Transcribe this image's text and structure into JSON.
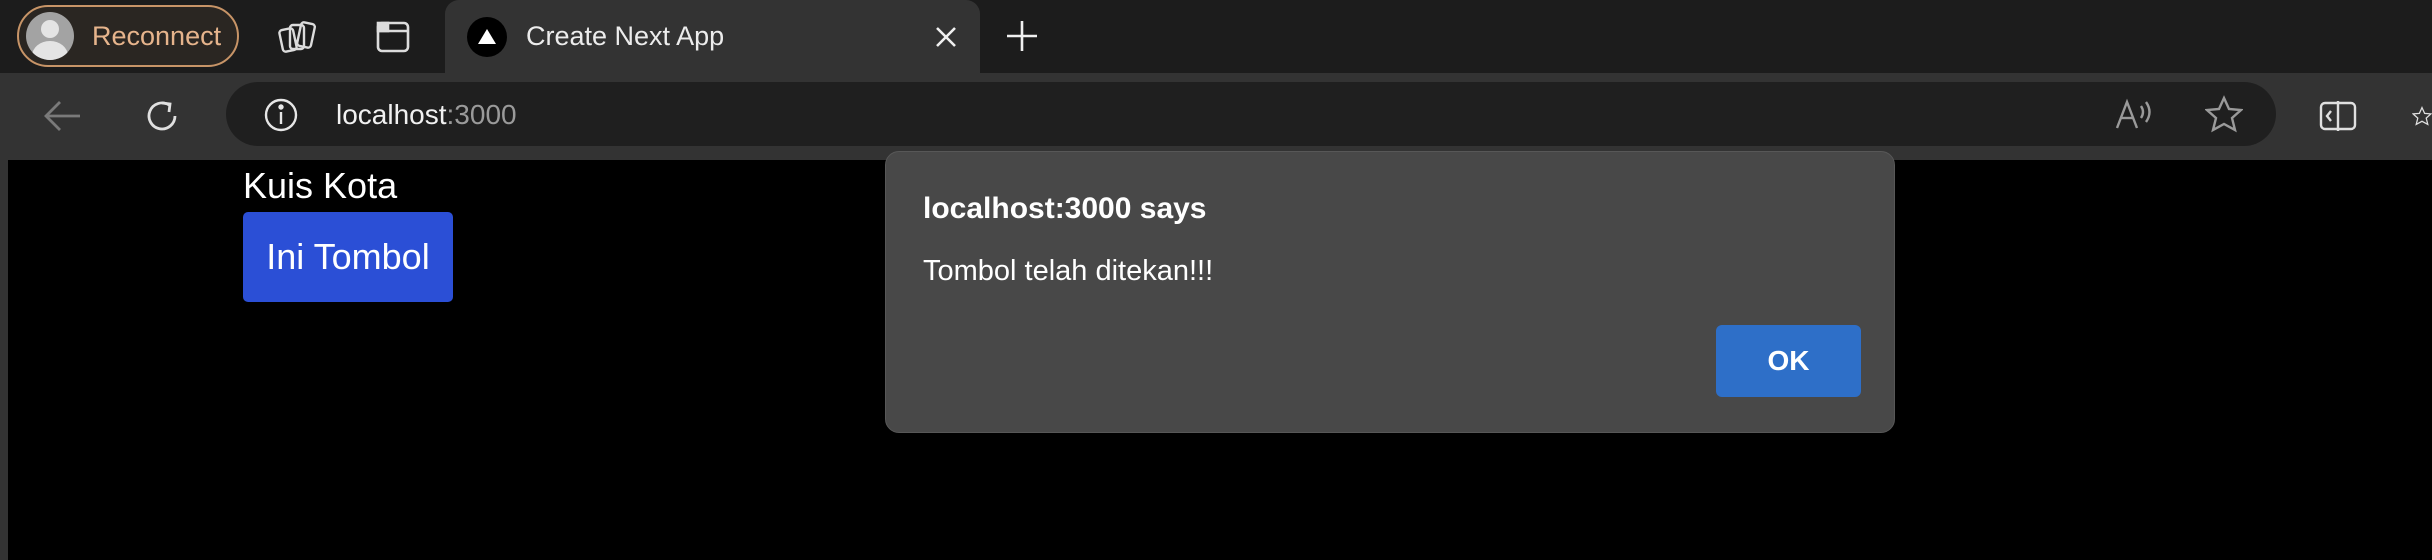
{
  "browser": {
    "profile_button": {
      "label": "Reconnect",
      "icon": "avatar-icon"
    },
    "workspaces_icon": "workspaces-icon",
    "vertical_tabs_icon": "tab-actions-icon",
    "active_tab": {
      "title": "Create Next App",
      "favicon": "nextjs-triangle-icon",
      "close_icon": "close-icon"
    },
    "new_tab_icon": "plus-icon",
    "address_bar": {
      "host": "localhost",
      "port": ":3000",
      "info_icon": "info-icon"
    },
    "nav": {
      "back_icon": "back-arrow-icon",
      "refresh_icon": "refresh-icon"
    },
    "toolbar_right": {
      "read_aloud_icon": "read-aloud-icon",
      "favorite_icon": "star-icon",
      "split_screen_icon": "split-screen-icon"
    },
    "accent_color": "#c79467"
  },
  "page": {
    "title": "Kuis Kota",
    "button_label": "Ini Tombol",
    "button_color": "#2b4fd6"
  },
  "dialog": {
    "title": "localhost:3000 says",
    "message": "Tombol telah ditekan!!!",
    "ok_label": "OK",
    "ok_color": "#2e6fc8"
  }
}
